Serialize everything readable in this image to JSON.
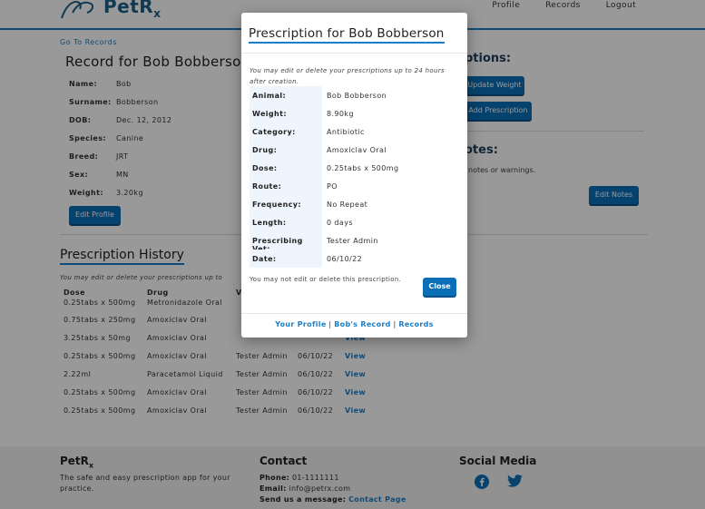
{
  "nav": {
    "brand": "PetR",
    "brand_sub": "x",
    "links": [
      "Profile",
      "Records",
      "Logout"
    ]
  },
  "record": {
    "go_to_records": "Go To Records",
    "title": "Record for Bob Bobberson",
    "fields": [
      {
        "label": "Name:",
        "value": "Bob"
      },
      {
        "label": "Surname:",
        "value": "Bobberson"
      },
      {
        "label": "DOB:",
        "value": "Dec. 12, 2012"
      },
      {
        "label": "Species:",
        "value": "Canine"
      },
      {
        "label": "Breed:",
        "value": "JRT"
      },
      {
        "label": "Sex:",
        "value": "MN"
      },
      {
        "label": "Weight:",
        "value": "3.20kg"
      }
    ],
    "edit_profile": "Edit Profile"
  },
  "options": {
    "title": "ptions:",
    "update_weight": "Update Weight",
    "add_prescription": "Add Prescription",
    "notes_title": "otes:",
    "notes_text": "notes or warnings.",
    "edit_notes": "Edit Notes"
  },
  "history": {
    "title": "Prescription History",
    "note": "You may edit or delete your prescriptions up to",
    "headers": [
      "Dose",
      "Drug",
      "V"
    ],
    "rows": [
      {
        "dose": "0.25tabs x 500mg",
        "drug": "Metronidazole Oral",
        "vet": "",
        "date": "",
        "view": ""
      },
      {
        "dose": "0.75tabs x 250mg",
        "drug": "Amoxiclav Oral",
        "vet": "",
        "date": "",
        "view": ""
      },
      {
        "dose": "3.25tabs x 50mg",
        "drug": "Amoxiclav Oral",
        "vet": "",
        "date": "",
        "view": "View"
      },
      {
        "dose": "0.25tabs x 500mg",
        "drug": "Amoxiclav Oral",
        "vet": "Tester Admin",
        "date": "06/10/22",
        "view": "View"
      },
      {
        "dose": "2.22ml",
        "drug": "Paracetamol Liquid",
        "vet": "Tester Admin",
        "date": "06/10/22",
        "view": "View"
      },
      {
        "dose": "0.25tabs x 500mg",
        "drug": "Amoxiclav Oral",
        "vet": "Tester Admin",
        "date": "06/10/22",
        "view": "View"
      },
      {
        "dose": "0.25tabs x 500mg",
        "drug": "Amoxiclav Oral",
        "vet": "Tester Admin",
        "date": "06/10/22",
        "view": "View"
      }
    ]
  },
  "footer": {
    "brand": "PetR",
    "brand_sub": "x",
    "description": "The safe and easy prescription app for your practice.",
    "contact_title": "Contact",
    "phone_label": "Phone:",
    "phone": "01-1111111",
    "email_label": "Email:",
    "email": "info@petrx.com",
    "message_label": "Send us a message:",
    "message_link": "Contact Page",
    "social_title": "Social Media",
    "icons": [
      "facebook-icon",
      "twitter-icon"
    ]
  },
  "modal": {
    "title": "Prescription for Bob Bobberson",
    "note": "You may edit or delete your prescriptions up to 24 hours after creation.",
    "details": [
      {
        "label": "Animal:",
        "value": "Bob Bobberson"
      },
      {
        "label": "Weight:",
        "value": "8.90kg"
      },
      {
        "label": "Category:",
        "value": "Antibiotic"
      },
      {
        "label": "Drug:",
        "value": "Amoxiclav Oral"
      },
      {
        "label": "Dose:",
        "value": "0.25tabs x 500mg"
      },
      {
        "label": "Route:",
        "value": "PO"
      },
      {
        "label": "Frequency:",
        "value": "No Repeat"
      },
      {
        "label": "Length:",
        "value": "0 days"
      },
      {
        "label": "Prescribing Vet:",
        "value": "Tester Admin"
      },
      {
        "label": "Date:",
        "value": "06/10/22"
      }
    ],
    "cannot_edit": "You may not edit or delete this prescription.",
    "close": "Close",
    "links": {
      "profile": "Your Profile",
      "record": "Bob's Record",
      "records": "Records",
      "sep": "|"
    }
  },
  "colors": {
    "accent": "#1a7ec9",
    "button": "#0b6fb8",
    "overlay": "rgba(0,0,0,0.4)"
  }
}
